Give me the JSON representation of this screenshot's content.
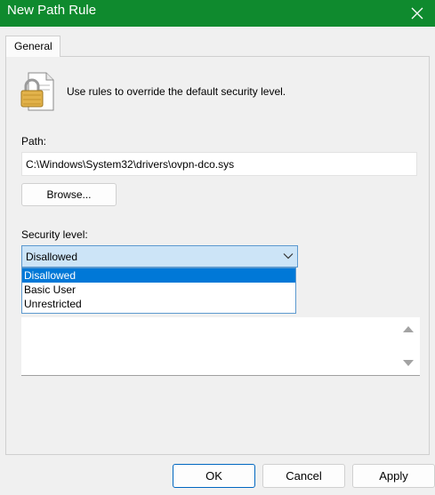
{
  "window": {
    "title": "New Path Rule"
  },
  "tabs": [
    {
      "label": "General"
    }
  ],
  "general": {
    "intro_text": "Use rules to override the default security level.",
    "path_label": "Path:",
    "path_value": "C:\\Windows\\System32\\drivers\\ovpn-dco.sys",
    "browse_label": "Browse...",
    "security_level_label": "Security level:",
    "security_level_value": "Disallowed",
    "security_level_options": [
      "Disallowed",
      "Basic User",
      "Unrestricted"
    ],
    "description_value": ""
  },
  "footer": {
    "ok_label": "OK",
    "cancel_label": "Cancel",
    "apply_label": "Apply"
  },
  "colors": {
    "titlebar": "#0f8a2e",
    "selection": "#0078d7",
    "combo_fill": "#cce4f7"
  },
  "icons": {
    "title_close": "close-icon",
    "rule": "padlock-document-icon",
    "combo": "chevron-down-icon",
    "scroll_up": "triangle-up-icon",
    "scroll_down": "triangle-down-icon"
  }
}
